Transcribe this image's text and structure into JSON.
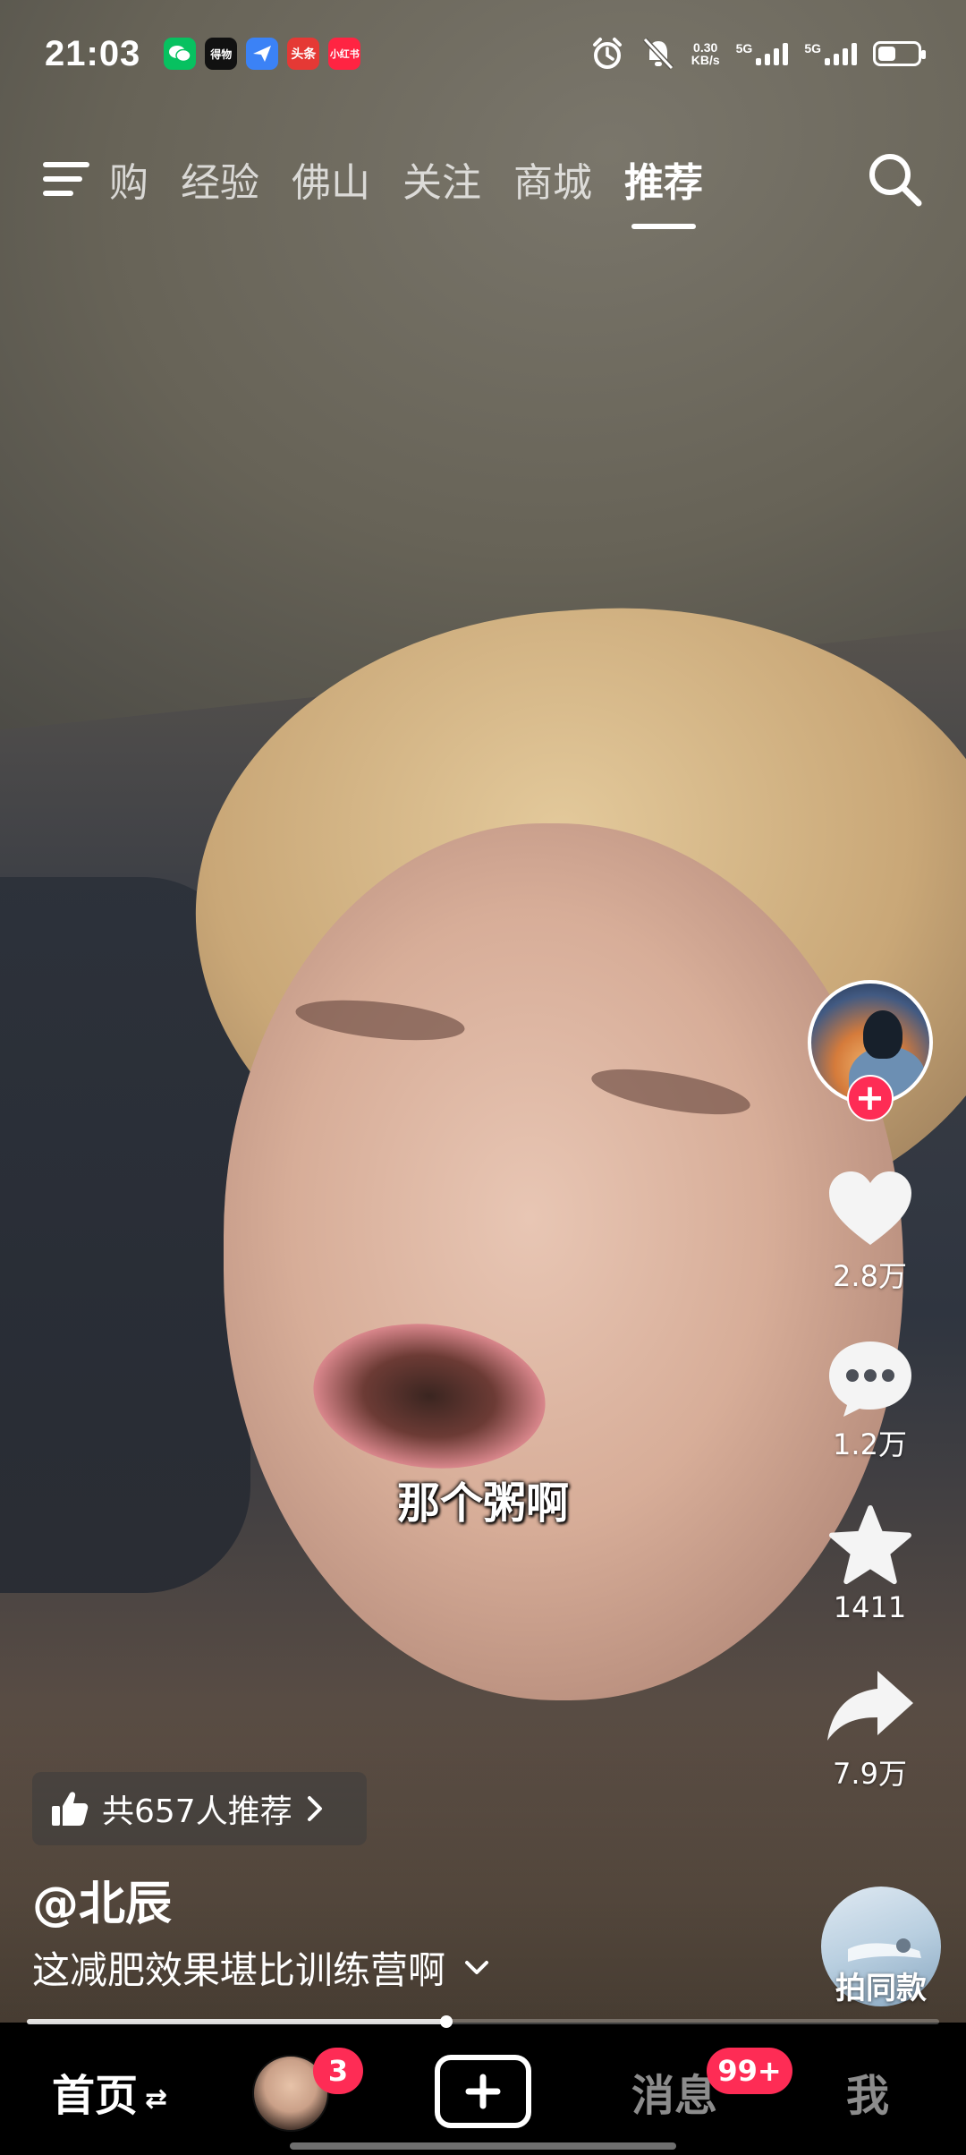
{
  "status_bar": {
    "time": "21:03",
    "app_icons": [
      {
        "icon": "wechat-icon",
        "label": "",
        "bg": "#07c160"
      },
      {
        "icon": "dewu-icon",
        "label": "得物",
        "bg": "#111111"
      },
      {
        "icon": "paper-plane-icon",
        "label": "",
        "bg": "#3b82f6"
      },
      {
        "icon": "toutiao-icon",
        "label": "头条",
        "bg": "#e53935"
      },
      {
        "icon": "xiaohongshu-icon",
        "label": "小红书",
        "bg": "#ff2442"
      }
    ],
    "net_speed_value": "0.30",
    "net_speed_unit": "KB/s",
    "sim1": "5G",
    "sim2": "5G",
    "battery_level": 0.45
  },
  "topnav": {
    "tabs": [
      {
        "label": "购",
        "partial": true
      },
      {
        "label": "经验"
      },
      {
        "label": "佛山"
      },
      {
        "label": "关注"
      },
      {
        "label": "商城"
      },
      {
        "label": "推荐",
        "active": true
      }
    ]
  },
  "video": {
    "subtitle": "那个粥啊",
    "recommend_text": "共657人推荐",
    "username": "@北辰",
    "description": "这减肥效果堪比训练营啊",
    "progress": 0.46
  },
  "actions": {
    "like_count": "2.8万",
    "comment_count": "1.2万",
    "favorite_count": "1411",
    "share_count": "7.9万",
    "make_same_label": "拍同款"
  },
  "bottom_nav": {
    "home": "首页",
    "friend_badge": "3",
    "messages": "消息",
    "messages_badge": "99+",
    "me": "我"
  },
  "colors": {
    "accent": "#fe2c55"
  }
}
